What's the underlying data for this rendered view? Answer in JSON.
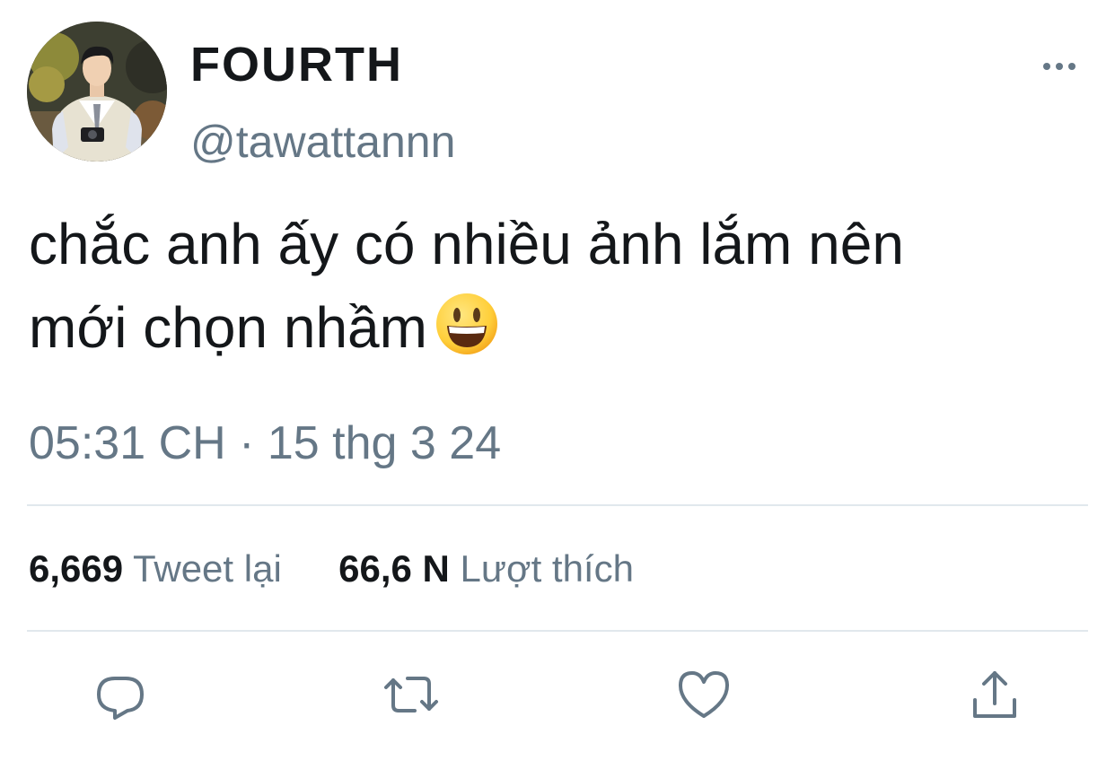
{
  "user": {
    "display_name": "FOURTH",
    "handle": "@tawattannn",
    "avatar_icon": "profile-photo"
  },
  "tweet": {
    "line1": "chắc anh ấy có nhiều ảnh lắm nên",
    "line2": "mới chọn nhầm",
    "emoji": "smiling-face-with-open-mouth",
    "timestamp": "05:31 CH · 15 thg 3 24"
  },
  "stats": {
    "retweets_count": "6,669",
    "retweets_label": "Tweet lại",
    "likes_count": "66,6 N",
    "likes_label": "Lượt thích"
  },
  "actions": {
    "reply_icon": "reply-icon",
    "retweet_icon": "retweet-icon",
    "like_icon": "heart-icon",
    "share_icon": "share-icon"
  },
  "colors": {
    "primary_text": "#14171a",
    "secondary_text": "#657786",
    "divider": "#e1e8ed",
    "background": "#ffffff"
  }
}
